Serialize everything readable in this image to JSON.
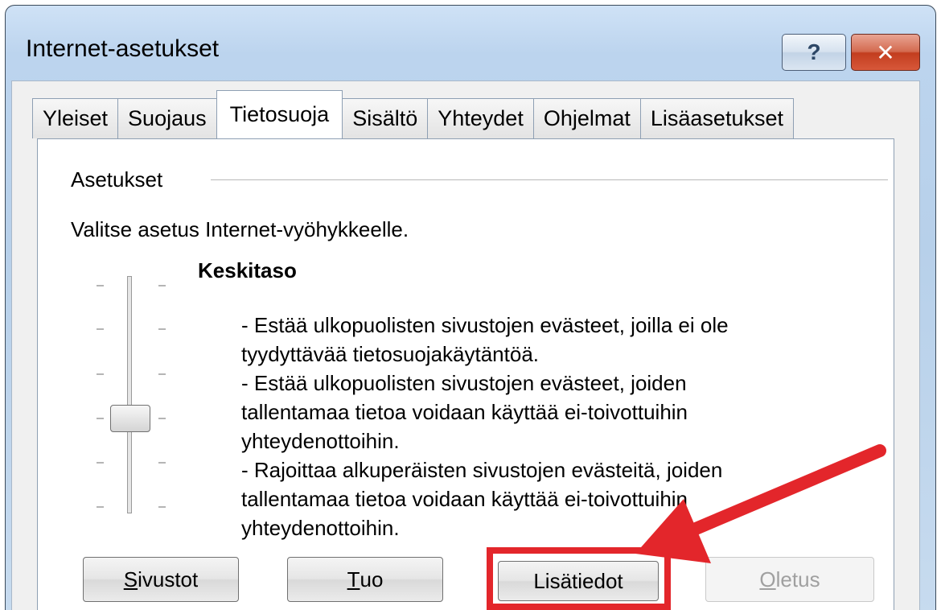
{
  "window": {
    "title": "Internet-asetukset",
    "help_label": "?",
    "close_label": "✕"
  },
  "tabs": [
    {
      "label": "Yleiset"
    },
    {
      "label": "Suojaus"
    },
    {
      "label": "Tietosuoja",
      "active": true
    },
    {
      "label": "Sisältö"
    },
    {
      "label": "Yhteydet"
    },
    {
      "label": "Ohjelmat"
    },
    {
      "label": "Lisäasetukset"
    }
  ],
  "settings": {
    "group_label": "Asetukset",
    "instruction": "Valitse asetus Internet-vyöhykkeelle.",
    "level_title": "Keskitaso",
    "description": "- Estää ulkopuolisten sivustojen evästeet, joilla ei ole\ntyydyttävää tietosuojakäytäntöä.\n- Estää ulkopuolisten sivustojen evästeet, joiden\ntallentamaa tietoa voidaan käyttää ei-toivottuihin\nyhteydenottoihin.\n- Rajoittaa alkuperäisten sivustojen evästeitä, joiden\ntallentamaa tietoa voidaan käyttää ei-toivottuihin\nyhteydenottoihin."
  },
  "buttons": {
    "sites": {
      "accel": "S",
      "rest": "ivustot"
    },
    "import": {
      "accel": "T",
      "rest": "uo"
    },
    "advanced": {
      "label": "Lisätiedot"
    },
    "default": {
      "accel": "O",
      "rest": "letus",
      "disabled": true
    }
  },
  "colors": {
    "highlight": "#e3262b"
  }
}
